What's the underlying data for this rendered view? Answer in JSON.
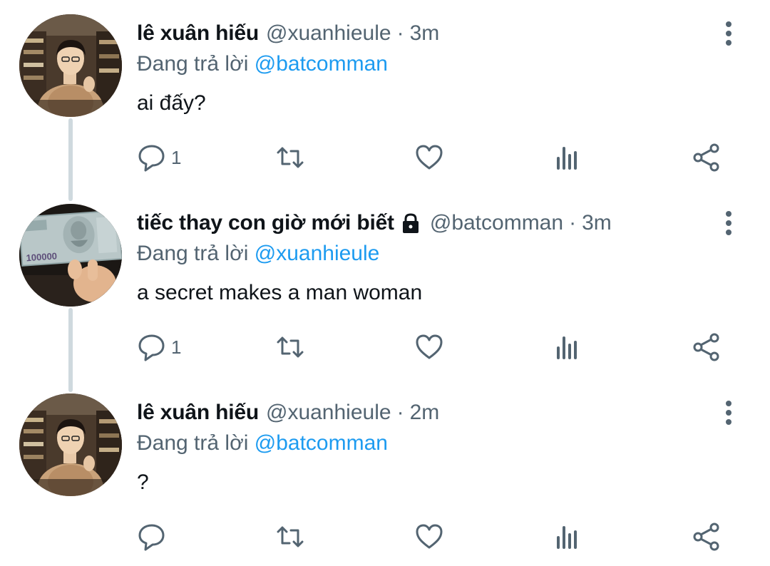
{
  "colors": {
    "text": "#0f1419",
    "secondary": "#536471",
    "link": "#1d9bf0",
    "thread_line": "#cfd9de"
  },
  "tweets": [
    {
      "name": "lê xuân hiếu",
      "handle": "@xuanhieule",
      "separator": "·",
      "time": "3m",
      "reply_prefix": "Đang trả lời",
      "reply_to": "@batcomman",
      "text": "ai đấy?",
      "reply_count": "1",
      "locked": false,
      "avatar": "person-photo"
    },
    {
      "name": "tiếc thay con giờ mới biết",
      "handle": "@batcomman",
      "separator": "·",
      "time": "3m",
      "reply_prefix": "Đang trả lời",
      "reply_to": "@xuanhieule",
      "text": "a secret makes a man woman",
      "reply_count": "1",
      "locked": true,
      "avatar": "banknote-photo"
    },
    {
      "name": "lê xuân hiếu",
      "handle": "@xuanhieule",
      "separator": "·",
      "time": "2m",
      "reply_prefix": "Đang trả lời",
      "reply_to": "@batcomman",
      "text": "?",
      "reply_count": "",
      "locked": false,
      "avatar": "person-photo"
    }
  ],
  "icons": {
    "reply": "speech-bubble-icon",
    "retweet": "retweet-icon",
    "like": "heart-icon",
    "stats": "bar-chart-icon",
    "share": "share-icon",
    "more": "vertical-dots-icon",
    "lock": "lock-icon"
  }
}
